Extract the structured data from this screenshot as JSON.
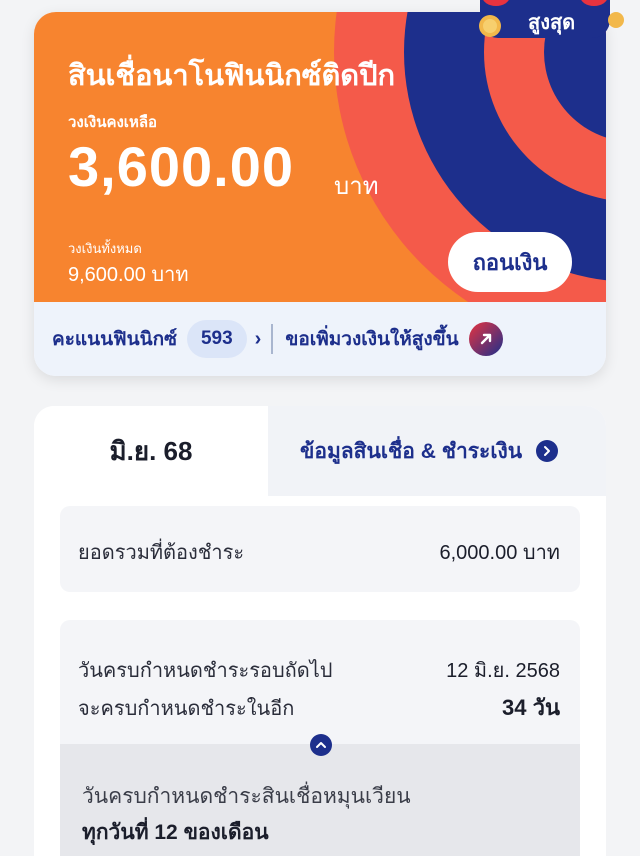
{
  "badge": {
    "text": "สูงสุด"
  },
  "card": {
    "title": "สินเชื่อนาโนฟินนิกซ์ติดปีก",
    "remaining_label": "วงเงินคงเหลือ",
    "remaining_amount": "3,600.00",
    "remaining_unit": "บาท",
    "total_label": "วงเงินทั้งหมด",
    "total_amount": "9,600.00 บาท",
    "withdraw_button": "ถอนเงิน",
    "score_label": "คะแนนฟินนิกซ์",
    "score_value": "593",
    "increase_link": "ขอเพิ่มวงเงินให้สูงขึ้น",
    "colors": {
      "orange": "#f7842f",
      "coral": "#f45a4a",
      "navy": "#1d2f8c"
    }
  },
  "bill": {
    "month_tab": "มิ.ย. 68",
    "info_tab": "ข้อมูลสินเชื่อ & ชำระเงิน",
    "total_due_label": "ยอดรวมที่ต้องชำระ",
    "total_due_value": "6,000.00 บาท",
    "next_due_label": "วันครบกำหนดชำระรอบถัดไป",
    "next_due_value": "12 มิ.ย. 2568",
    "days_left_label": "จะครบกำหนดชำระในอีก",
    "days_left_value": "34 วัน",
    "revolving_label": "วันครบกำหนดชำระสินเชื่อหมุนเวียน",
    "revolving_value": "ทุกวันที่ 12 ของเดือน"
  }
}
